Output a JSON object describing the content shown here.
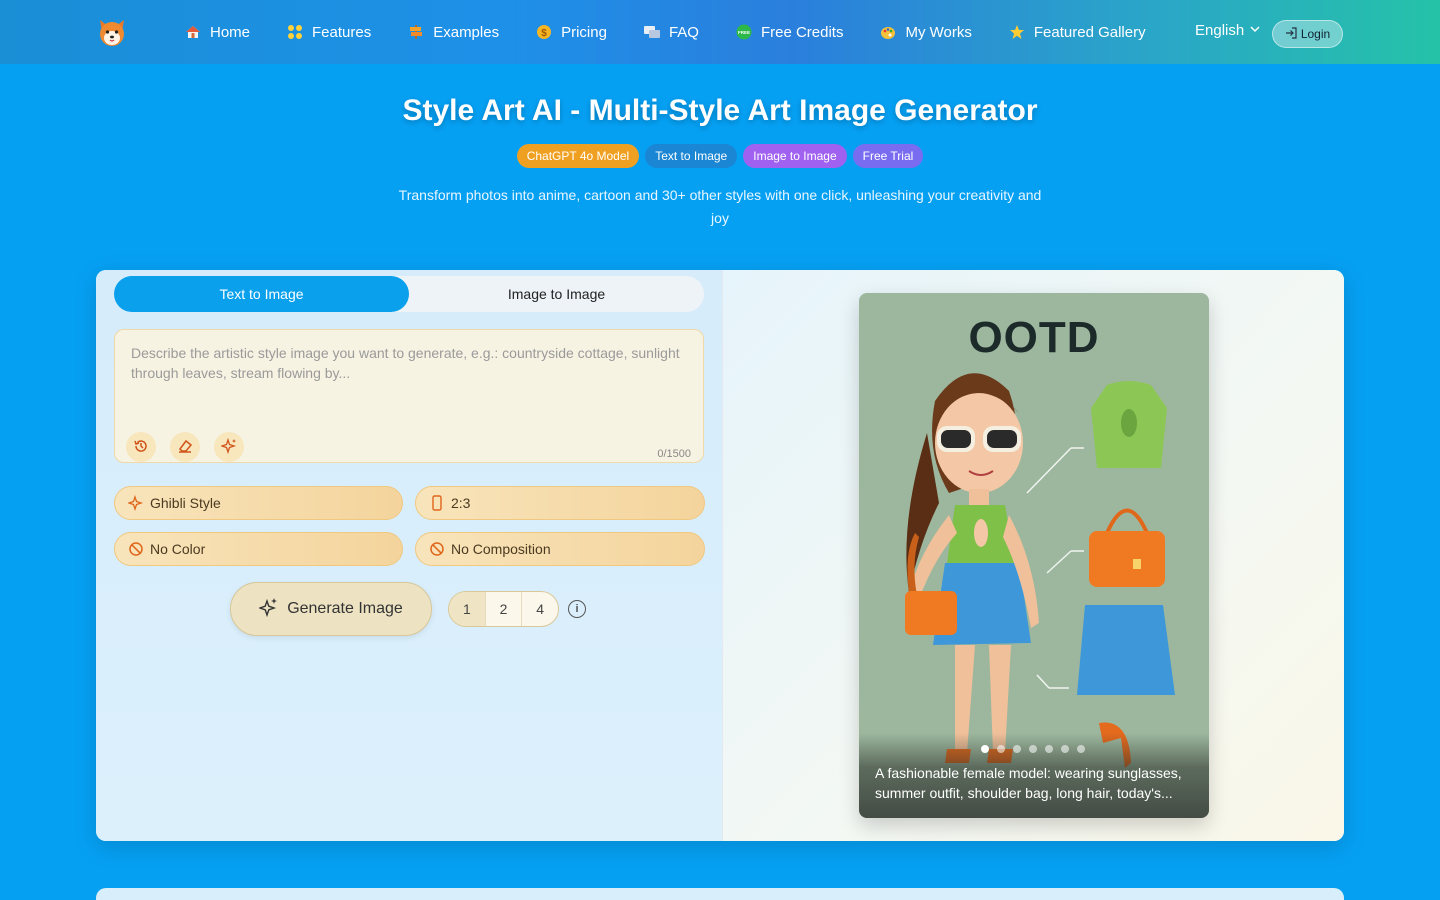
{
  "nav": {
    "items": [
      {
        "label": "Home",
        "icon": "house-icon"
      },
      {
        "label": "Features",
        "icon": "grid-icon"
      },
      {
        "label": "Examples",
        "icon": "signpost-icon"
      },
      {
        "label": "Pricing",
        "icon": "coin-icon"
      },
      {
        "label": "FAQ",
        "icon": "chat-icon"
      },
      {
        "label": "Free Credits",
        "icon": "free-badge-icon"
      },
      {
        "label": "My Works",
        "icon": "palette-icon"
      },
      {
        "label": "Featured Gallery",
        "icon": "star-icon"
      }
    ],
    "language": "English",
    "login": "Login",
    "free_badge": "FREE"
  },
  "hero": {
    "title": "Style Art AI - Multi-Style Art Image Generator",
    "badges": [
      {
        "label": "ChatGPT 4o Model",
        "color": "#f0a020"
      },
      {
        "label": "Text to Image",
        "color": "#1a86d4"
      },
      {
        "label": "Image to Image",
        "color": "#a060f0"
      },
      {
        "label": "Free Trial",
        "color": "#7a6cf0"
      }
    ],
    "subtitle": "Transform photos into anime, cartoon and 30+ other styles with one click, unleashing your creativity and joy"
  },
  "tabs": [
    {
      "label": "Text to Image",
      "active": true
    },
    {
      "label": "Image to Image",
      "active": false
    }
  ],
  "prompt": {
    "placeholder": "Describe the artistic style image you want to generate, e.g.: countryside cottage, sunlight through leaves, stream flowing by...",
    "value": "",
    "counter": "0/1500"
  },
  "options": {
    "style": "Ghibli Style",
    "ratio": "2:3",
    "color": "No Color",
    "composition": "No Composition"
  },
  "generate": {
    "label": "Generate Image",
    "counts": [
      "1",
      "2",
      "4"
    ],
    "selected": "1"
  },
  "preview": {
    "heading": "OOTD",
    "caption": "A fashionable female model: wearing sunglasses, summer outfit, shoulder bag, long hair, today's...",
    "slides": 7,
    "current_slide": 1
  }
}
